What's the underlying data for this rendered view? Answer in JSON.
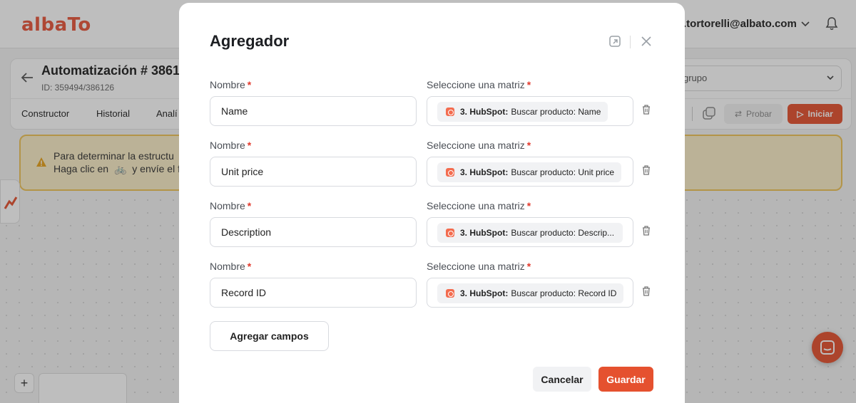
{
  "app": {
    "logo": "albaTo",
    "user_email": ".tortorelli@albato.com",
    "automation_title": "Automatización # 3861",
    "automation_id": "ID: 359494/386126",
    "tabs": [
      "Constructor",
      "Historial",
      "Analí"
    ],
    "group_select": "grupo",
    "buttons": {
      "probar": "Probar",
      "iniciar": "Iniciar"
    },
    "warning": {
      "line1": "Para determinar la estructu",
      "line2_pre": "Haga clic en",
      "line2_post": "y envíe el f"
    },
    "zoom_plus": "+"
  },
  "modal": {
    "title": "Agregador",
    "rows": [
      {
        "name_label": "Nombre",
        "name_value": "Name",
        "matrix_label": "Seleccione una matriz",
        "chip_source": "3. HubSpot:",
        "chip_text": "Buscar producto: Name"
      },
      {
        "name_label": "Nombre",
        "name_value": "Unit price",
        "matrix_label": "Seleccione una matriz",
        "chip_source": "3. HubSpot:",
        "chip_text": "Buscar producto: Unit price"
      },
      {
        "name_label": "Nombre",
        "name_value": "Description",
        "matrix_label": "Seleccione una matriz",
        "chip_source": "3. HubSpot:",
        "chip_text": "Buscar producto: Descrip..."
      },
      {
        "name_label": "Nombre",
        "name_value": "Record ID",
        "matrix_label": "Seleccione una matriz",
        "chip_source": "3. HubSpot:",
        "chip_text": "Buscar producto: Record ID"
      }
    ],
    "required_mark": "*",
    "add_fields": "Agregar campos",
    "cancel": "Cancelar",
    "save": "Guardar"
  },
  "colors": {
    "accent": "#e5512f",
    "required": "#e23b2e",
    "warning_bg": "#fbeec7",
    "warning_border": "#f0c356"
  }
}
